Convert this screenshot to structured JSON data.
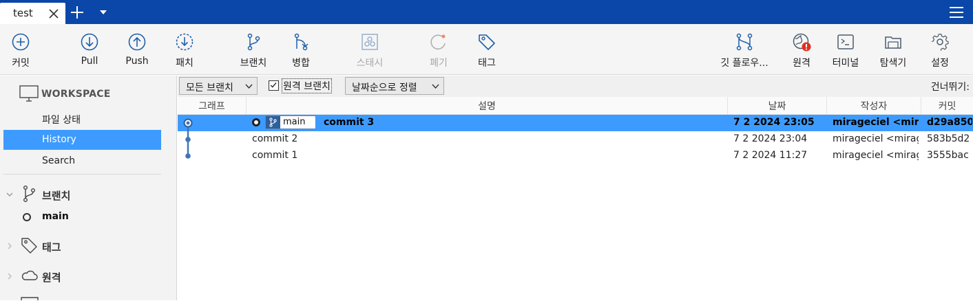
{
  "tabs": {
    "active_title": "test"
  },
  "toolbar": {
    "commit": "커밋",
    "pull": "Pull",
    "push": "Push",
    "fetch": "패치",
    "branch": "브랜치",
    "merge": "병합",
    "stash": "스태시",
    "discard": "폐기",
    "tag": "태그",
    "git_flow": "깃 플로우...",
    "remote": "원격",
    "terminal": "터미널",
    "explorer": "탐색기",
    "settings": "설정"
  },
  "sidebar": {
    "workspace": "WORKSPACE",
    "items": [
      {
        "label": "파일 상태"
      },
      {
        "label": "History"
      },
      {
        "label": "Search"
      }
    ],
    "branches_label": "브랜치",
    "current_branch": "main",
    "tags_label": "태그",
    "remotes_label": "원격"
  },
  "filters": {
    "branch_filter": "모든 브랜치",
    "remote_branches": "원격 브랜치",
    "sort": "날짜순으로 정렬",
    "jump_to": "건너뛰기:"
  },
  "table": {
    "columns": [
      "그래프",
      "설명",
      "날짜",
      "작성자",
      "커밋"
    ],
    "rows": [
      {
        "ref": "main",
        "description": "commit 3",
        "date": "7 2 2024 23:05",
        "author": "mirageciel <mirag",
        "hash": "d29a850"
      },
      {
        "ref": "",
        "description": "commit 2",
        "date": "7 2 2024 23:04",
        "author": "mirageciel <mirag",
        "hash": "583b5d2"
      },
      {
        "ref": "",
        "description": "commit 1",
        "date": "7 2 2024 11:27",
        "author": "mirageciel <mirag",
        "hash": "3555bac"
      }
    ]
  },
  "colors": {
    "accent": "#0b47a8",
    "selection": "#3d9bff",
    "icon": "#1f5fa8",
    "alert": "#e0301e"
  }
}
